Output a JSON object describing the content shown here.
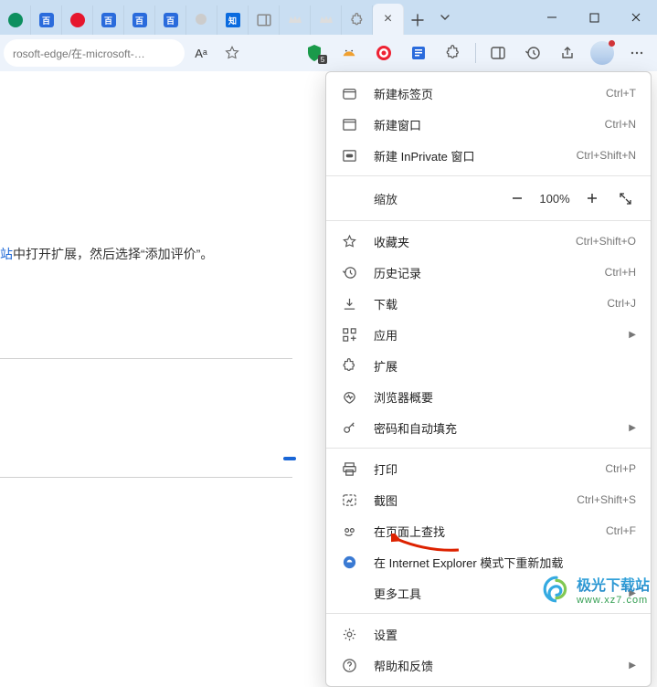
{
  "titlebar": {
    "tab_chevron": "⌄",
    "newtab_tooltip": "新建标签页",
    "tabs": [
      {
        "name": "tab-edge",
        "kind": "green"
      },
      {
        "name": "tab-baidu-1",
        "kind": "bp",
        "txt": "百"
      },
      {
        "name": "tab-weibo",
        "kind": "wb"
      },
      {
        "name": "tab-baidu-2",
        "kind": "bp",
        "txt": "百"
      },
      {
        "name": "tab-baidu-3",
        "kind": "bp",
        "txt": "百"
      },
      {
        "name": "tab-baidu-4",
        "kind": "bp",
        "txt": "百"
      },
      {
        "name": "tab-generic-1",
        "kind": "generic"
      },
      {
        "name": "tab-zhihu",
        "kind": "zh",
        "txt": "知"
      },
      {
        "name": "tab-panel",
        "kind": "panel"
      },
      {
        "name": "tab-dark-1",
        "kind": "crown"
      },
      {
        "name": "tab-dark-2",
        "kind": "crown"
      },
      {
        "name": "tab-ext",
        "kind": "puz"
      },
      {
        "name": "tab-active",
        "kind": "active",
        "close": "×"
      }
    ]
  },
  "window": {
    "min": "—",
    "max": "◻",
    "close": "✕"
  },
  "toolbar": {
    "address": "rosoft-edge/在-microsoft-…",
    "reader_label": "Aᵃ",
    "shield_badge": "5"
  },
  "page": {
    "frag_link": "站",
    "frag_mid": "中打开扩展，然后选择",
    "frag_quote": "“添加评价”",
    "frag_end": "。"
  },
  "menu": {
    "items": [
      {
        "id": "new-tab",
        "label": "新建标签页",
        "shortcut": "Ctrl+T",
        "icon": "tab"
      },
      {
        "id": "new-window",
        "label": "新建窗口",
        "shortcut": "Ctrl+N",
        "icon": "window"
      },
      {
        "id": "new-inprivate",
        "label": "新建 InPrivate 窗口",
        "shortcut": "Ctrl+Shift+N",
        "icon": "inprivate"
      },
      {
        "sep": true
      },
      {
        "id": "zoom",
        "label": "缩放",
        "pct": "100%"
      },
      {
        "sep": true
      },
      {
        "id": "favorites",
        "label": "收藏夹",
        "shortcut": "Ctrl+Shift+O",
        "icon": "star"
      },
      {
        "id": "history",
        "label": "历史记录",
        "shortcut": "Ctrl+H",
        "icon": "history"
      },
      {
        "id": "downloads",
        "label": "下载",
        "shortcut": "Ctrl+J",
        "icon": "download"
      },
      {
        "id": "apps",
        "label": "应用",
        "sub": true,
        "icon": "apps"
      },
      {
        "id": "extensions",
        "label": "扩展",
        "icon": "ext"
      },
      {
        "id": "essentials",
        "label": "浏览器概要",
        "icon": "pulse"
      },
      {
        "id": "passwords",
        "label": "密码和自动填充",
        "sub": true,
        "icon": "key"
      },
      {
        "sep": true
      },
      {
        "id": "print",
        "label": "打印",
        "shortcut": "Ctrl+P",
        "icon": "print"
      },
      {
        "id": "screenshot",
        "label": "截图",
        "shortcut": "Ctrl+Shift+S",
        "icon": "shot"
      },
      {
        "id": "find",
        "label": "在页面上查找",
        "shortcut": "Ctrl+F",
        "icon": "find"
      },
      {
        "id": "ie-mode",
        "label": "在 Internet Explorer 模式下重新加载",
        "icon": "ie"
      },
      {
        "id": "more-tools",
        "label": "更多工具",
        "sub": true,
        "icon": ""
      },
      {
        "sep": true
      },
      {
        "id": "settings",
        "label": "设置",
        "icon": "gear"
      },
      {
        "id": "help",
        "label": "帮助和反馈",
        "sub": true,
        "icon": "help"
      }
    ]
  },
  "watermark": {
    "name": "极光下载站",
    "url": "www.xz7.com"
  }
}
